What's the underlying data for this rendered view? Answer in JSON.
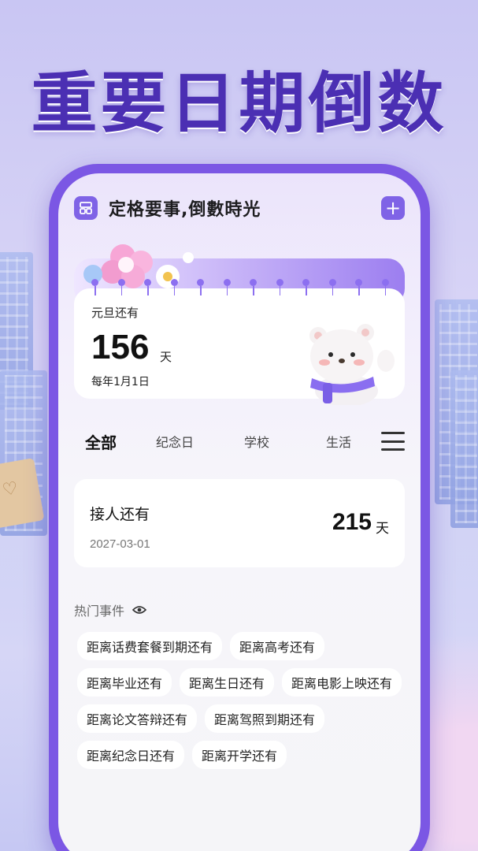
{
  "headline": "重要日期倒数",
  "app": {
    "title": "定格要事,倒數時光",
    "menu_icon": "grid-icon",
    "add_icon": "plus-icon",
    "add_label": "+"
  },
  "hero": {
    "label": "元旦还有",
    "days": "156",
    "unit": "天",
    "date": "每年1月1日"
  },
  "tabs": [
    {
      "label": "全部",
      "active": true
    },
    {
      "label": "纪念日",
      "active": false
    },
    {
      "label": "学校",
      "active": false
    },
    {
      "label": "生活",
      "active": false
    }
  ],
  "event": {
    "name": "接人还有",
    "date": "2027-03-01",
    "days": "215",
    "unit": "天"
  },
  "hot": {
    "title": "热门事件",
    "icon": "eye-icon",
    "chips": [
      "距离话费套餐到期还有",
      "距离高考还有",
      "距离毕业还有",
      "距离生日还有",
      "距离电影上映还有",
      "距离论文答辩还有",
      "距离驾照到期还有",
      "距离纪念日还有",
      "距离开学还有"
    ]
  },
  "colors": {
    "brand": "#7b57e4",
    "headline": "#4b2fb3"
  }
}
